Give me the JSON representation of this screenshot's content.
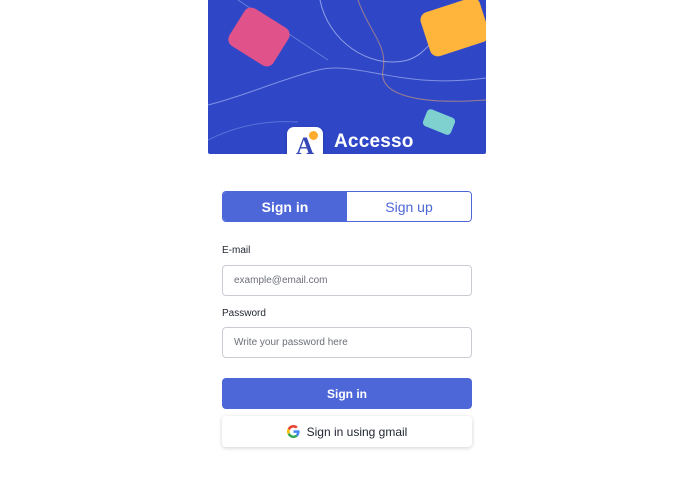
{
  "brand": {
    "name": "Accesso",
    "logo_letter": "A"
  },
  "tabs": [
    {
      "label": "Sign in",
      "active": true
    },
    {
      "label": "Sign up",
      "active": false
    }
  ],
  "form": {
    "email": {
      "label": "E-mail",
      "placeholder": "example@email.com",
      "value": ""
    },
    "password": {
      "label": "Password",
      "placeholder": "Write your password here",
      "value": ""
    }
  },
  "actions": {
    "sign_in_label": "Sign in",
    "google_label": "Sign in using gmail"
  },
  "colors": {
    "hero_bg": "#2f47c7",
    "accent": "#4e67d8",
    "pink": "#e0528a",
    "yellow": "#ffb43c",
    "teal": "#7fd1cf"
  }
}
